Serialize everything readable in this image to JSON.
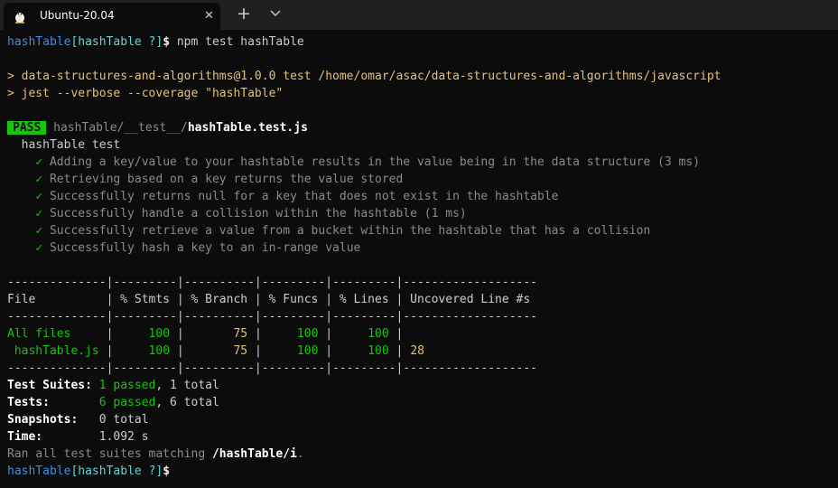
{
  "tab": {
    "title": "Ubuntu-20.04",
    "close": "✕"
  },
  "toolbar": {
    "new_tab": "+"
  },
  "prompt": {
    "dir": "hashTable",
    "branch": "[hashTable ?]",
    "symbol": "$",
    "command": " npm test hashTable"
  },
  "script": {
    "line1": "> data-structures-and-algorithms@1.0.0 test /home/omar/asac/data-structures-and-algorithms/javascript",
    "line2": "> jest --verbose --coverage \"hashTable\""
  },
  "result": {
    "badge": "PASS",
    "path_prefix": "hashTable/__test__/",
    "path_file": "hashTable.test.js",
    "suite": "hashTable test",
    "check": "✓",
    "tests": [
      "Adding a key/value to your hashtable results in the value being in the data structure (3 ms)",
      "Retrieving based on a key returns the value stored",
      "Successfully returns null for a key that does not exist in the hashtable",
      "Successfully handle a collision within the hashtable (1 ms)",
      "Successfully retrieve a value from a bucket within the hashtable that has a collision",
      "Successfully hash a key to an in-range value"
    ]
  },
  "coverage": {
    "sep": "--------------|---------|----------|---------|---------|-------------------",
    "header": "File          | % Stmts | % Branch | % Funcs | % Lines | Uncovered Line #s",
    "rows": [
      {
        "file": "All files     ",
        "stmts": "     100",
        "branch": "       75",
        "funcs": "     100",
        "lines": "     100",
        "uncovered": ""
      },
      {
        "file": " hashTable.js ",
        "stmts": "     100",
        "branch": "       75",
        "funcs": "     100",
        "lines": "     100",
        "uncovered": "28"
      }
    ]
  },
  "summary": {
    "suites_label": "Test Suites:",
    "suites_passed": " 1 passed",
    "suites_total": ", 1 total",
    "tests_label": "Tests:      ",
    "tests_passed": " 6 passed",
    "tests_total": ", 6 total",
    "snapshots_label": "Snapshots:  ",
    "snapshots_value": " 0 total",
    "time_label": "Time:       ",
    "time_value": " 1.092 s",
    "ran_prefix": "Ran all test suites matching ",
    "ran_pattern": "/hashTable/i",
    "ran_suffix": "."
  },
  "colors": {
    "pass": "#16c60c",
    "prompt": "#3b8eea",
    "accent": "#e5c07b"
  }
}
